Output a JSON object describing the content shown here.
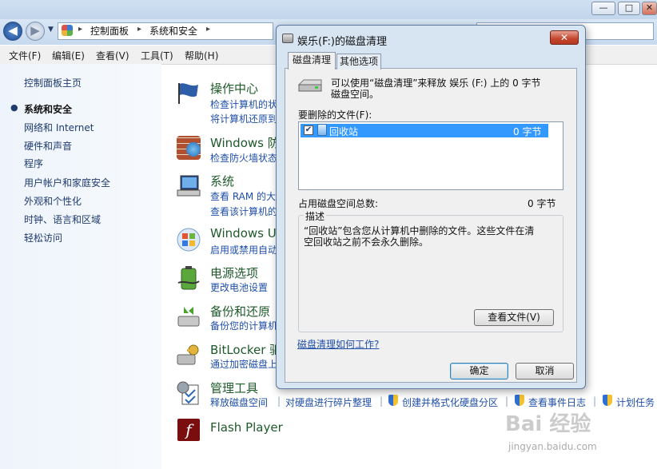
{
  "window": {
    "btn_min": "—",
    "btn_max": "□",
    "btn_close": "✕"
  },
  "address": {
    "crumb1": "控制面板",
    "crumb2": "系统和安全",
    "arrow": "▸"
  },
  "menu": {
    "file": "文件(F)",
    "edit": "编辑(E)",
    "view": "查看(V)",
    "tools": "工具(T)",
    "help": "帮助(H)"
  },
  "sidebar": {
    "home": "控制面板主页",
    "items": [
      "系统和安全",
      "网络和 Internet",
      "硬件和声音",
      "程序",
      "用户帐户和家庭安全",
      "外观和个性化",
      "时钟、语言和区域",
      "轻松访问"
    ]
  },
  "categories": {
    "action_center": {
      "title": "操作中心",
      "link1": "检查计算机的状",
      "link2": "将计算机还原到"
    },
    "firewall": {
      "title": "Windows 防",
      "link1": "检查防火墙状态"
    },
    "system": {
      "title": "系统",
      "link1": "查看 RAM 的大",
      "link2": "查看该计算机的"
    },
    "update": {
      "title": "Windows U",
      "link1": "启用或禁用自动"
    },
    "power": {
      "title": "电源选项",
      "link1": "更改电池设置"
    },
    "backup": {
      "title": "备份和还原",
      "link1": "备份您的计算机"
    },
    "bitlocker": {
      "title": "BitLocker 驱",
      "link1": "通过加密磁盘上"
    },
    "admin": {
      "title": "管理工具",
      "links": [
        "释放磁盘空间",
        "对硬盘进行碎片整理",
        "创建并格式化硬盘分区",
        "查看事件日志",
        "计划任务"
      ]
    },
    "flash": {
      "title": "Flash Player"
    }
  },
  "dialog": {
    "title": "娱乐(F:)的磁盘清理",
    "close": "✕",
    "tabs": [
      "磁盘清理",
      "其他选项"
    ],
    "intro": "可以使用“磁盘清理”来释放 娱乐 (F:) 上的 0 字节\n磁盘空间。",
    "files_label": "要删除的文件(F):",
    "file_item": {
      "name": "回收站",
      "size": "0 字节",
      "checked": true
    },
    "total_label": "占用磁盘空间总数:",
    "total_value": "0 字节",
    "desc_legend": "描述",
    "desc_text": "“回收站”包含您从计算机中删除的文件。这些文件在清\n空回收站之前不会永久删除。",
    "view_files": "查看文件(V)",
    "help_link": "磁盘清理如何工作?",
    "ok": "确定",
    "cancel": "取消"
  },
  "watermark": {
    "brand": "Bai 经验",
    "url": "jingyan.baidu.com"
  },
  "colors": {
    "link": "#1f4fa8",
    "heading": "#1e5a2a",
    "selection": "#3399ff"
  }
}
